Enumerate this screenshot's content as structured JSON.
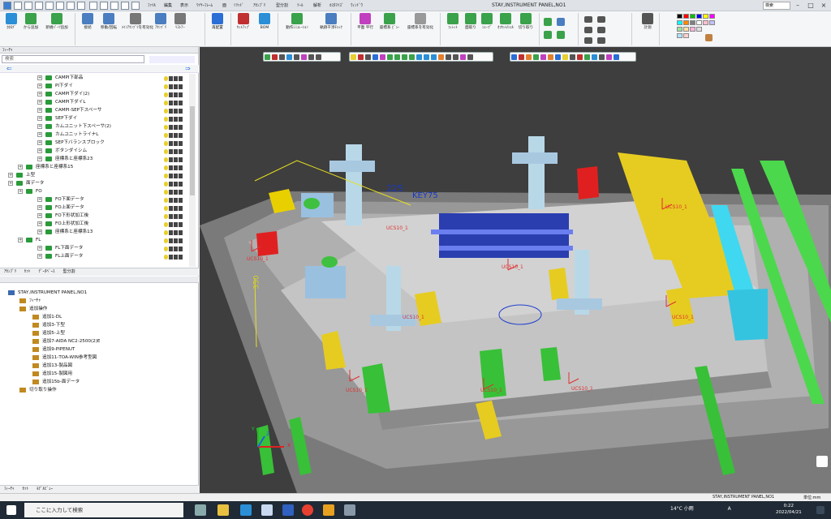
{
  "window": {
    "title": "STAY,INSTRUMENT PANEL,NO1",
    "menus": [
      "ﾌｧｲﾙ",
      "編集",
      "表示",
      "ﾜｲﾔｰﾌﾚｰﾑ",
      "面",
      "ｿﾘｯﾄﾞ",
      "ｱｾﾝﾌﾞﾘ",
      "型分割",
      "ﾂｰﾙ",
      "解析",
      "ｶｽﾀﾏｲｽﾞ",
      "ｳｨﾝﾄﾞｳ"
    ],
    "search_label": "検索"
  },
  "ribbon": {
    "buttons": [
      {
        "label": "ｶﾀﾛｸﾞ",
        "color": "#2a8fd6"
      },
      {
        "label": "から追加",
        "color": "#3aa24a"
      },
      {
        "label": "新規ﾊﾟｰﾂ追加",
        "color": "#3aa24a"
      },
      {
        "label": "接続",
        "color": "#4a7ec0"
      },
      {
        "label": "移動/回転",
        "color": "#4a7ec0"
      },
      {
        "label": "ﾒｲﾝｱｾﾝﾌﾞﾘを有効化",
        "color": "#777"
      },
      {
        "label": "ｱｾﾝﾌﾞﾘ",
        "color": "#4a7ec0"
      },
      {
        "label": "ﾘｽﾄｱｰ",
        "color": "#777"
      },
      {
        "label": "再配置",
        "color": "#2a6ed6"
      },
      {
        "label": "ｾｯﾄｱｯﾌﾟ",
        "color": "#c03030"
      },
      {
        "label": "BOM",
        "color": "#2a8fd6"
      },
      {
        "label": "動作ｼﾐｭﾚｰｼｮﾝ",
        "color": "#3aa24a"
      },
      {
        "label": "軌跡干渉ﾁｪｯｸ",
        "color": "#4a7ec0"
      },
      {
        "label": "平面 平行",
        "color": "#c040c0"
      },
      {
        "label": "座標系 ﾋﾞｭｰ",
        "color": "#3aa24a"
      },
      {
        "label": "座標系を有効化",
        "color": "#999"
      },
      {
        "label": "ﾌｨﾚｯﾄ",
        "color": "#3aa24a"
      },
      {
        "label": "面取り",
        "color": "#3aa24a"
      },
      {
        "label": "ｼｪｰﾌﾟ",
        "color": "#3aa24a"
      },
      {
        "label": "ｵﾌｾｯﾄ/ｼｪﾙ",
        "color": "#3aa24a"
      },
      {
        "label": "切り取り",
        "color": "#3aa24a"
      },
      {
        "label": "計測",
        "color": "#555"
      }
    ]
  },
  "left_panel": {
    "feature_header": "ﾌｨｰﾁｬ",
    "search_placeholder": "検索",
    "tree_items": [
      {
        "label": "CAMPI下部品",
        "indent": 54
      },
      {
        "label": "PI下ダイ",
        "indent": 54
      },
      {
        "label": "CAMPI下ダイ(2)",
        "indent": 54
      },
      {
        "label": "CAMPI下ダイL",
        "indent": 54
      },
      {
        "label": "CAMPI-SEP下スペーサ",
        "indent": 54
      },
      {
        "label": "SEP下ダイ",
        "indent": 54
      },
      {
        "label": "カムユニット下スペーサ(2)",
        "indent": 54
      },
      {
        "label": "カムユニットライナL",
        "indent": 54
      },
      {
        "label": "SEP下バランスブロック",
        "indent": 54
      },
      {
        "label": "ボタンダイシム",
        "indent": 54
      },
      {
        "label": "座標系と座標系23",
        "indent": 54
      },
      {
        "label": "座標系と座標系15",
        "indent": 30
      },
      {
        "label": "上型",
        "indent": 18
      },
      {
        "label": "面データ",
        "indent": 18
      },
      {
        "label": "FO",
        "indent": 30
      },
      {
        "label": "FO下面データ",
        "indent": 54
      },
      {
        "label": "FO上面データ",
        "indent": 54
      },
      {
        "label": "FO下形状加工後",
        "indent": 54
      },
      {
        "label": "FO上形状加工後",
        "indent": 54
      },
      {
        "label": "座標系と座標系13",
        "indent": 54
      },
      {
        "label": "FL",
        "indent": 30
      },
      {
        "label": "FL下面データ",
        "indent": 54
      },
      {
        "label": "FL上面データ",
        "indent": 54
      }
    ],
    "upper_tabs": [
      "ｱｾﾝﾌﾞﾘ",
      "ｾｯﾄ",
      "ﾃﾞｰﾀﾍﾞｰｽ",
      "型分割"
    ],
    "history_root": "STAY,INSTRUMENT PANEL,NO1",
    "history_items": [
      {
        "label": "ﾌｨｰﾁｬ",
        "indent": 24
      },
      {
        "label": "追加操作",
        "indent": 24
      },
      {
        "label": "追加1-DL",
        "indent": 40
      },
      {
        "label": "追加3-下型",
        "indent": 40
      },
      {
        "label": "追加5-上型",
        "indent": 40
      },
      {
        "label": "追加7-AIDA NC2-2500(2)E",
        "indent": 40
      },
      {
        "label": "追加9-PIPENUT",
        "indent": 40
      },
      {
        "label": "追加11-TOA-WIN参考型図",
        "indent": 40
      },
      {
        "label": "追加13-製品図",
        "indent": 40
      },
      {
        "label": "追加15-製図用",
        "indent": 40
      },
      {
        "label": "追加15b-面データ",
        "indent": 40
      },
      {
        "label": "切り取り操作",
        "indent": 24
      }
    ],
    "lower_tabs": [
      "ﾌｨｰﾁｬ",
      "ｾｯﾄ",
      "ﾓﾃﾞﾙﾋﾞｭｰ"
    ]
  },
  "viewport": {
    "dim_labels": [
      "225",
      "KEY75",
      "350"
    ],
    "ucs_labels": [
      "UCS10_1",
      "UCS10_1",
      "UCS10_1",
      "UCS10_1",
      "UCS10_1",
      "UCS10_1",
      "UCS10_1",
      "UCS10_1",
      "UCS10_1"
    ],
    "axis_labels": [
      "Z",
      "Y",
      "X"
    ]
  },
  "status": {
    "file": "STAY,INSTRUMENT PANEL,NO1",
    "unit": "単位:mm"
  },
  "taskbar": {
    "search_placeholder": "ここに入力して検索",
    "weather": "14°C 小雨",
    "ime": "A",
    "time": "0:22",
    "date": "2022/04/21"
  }
}
